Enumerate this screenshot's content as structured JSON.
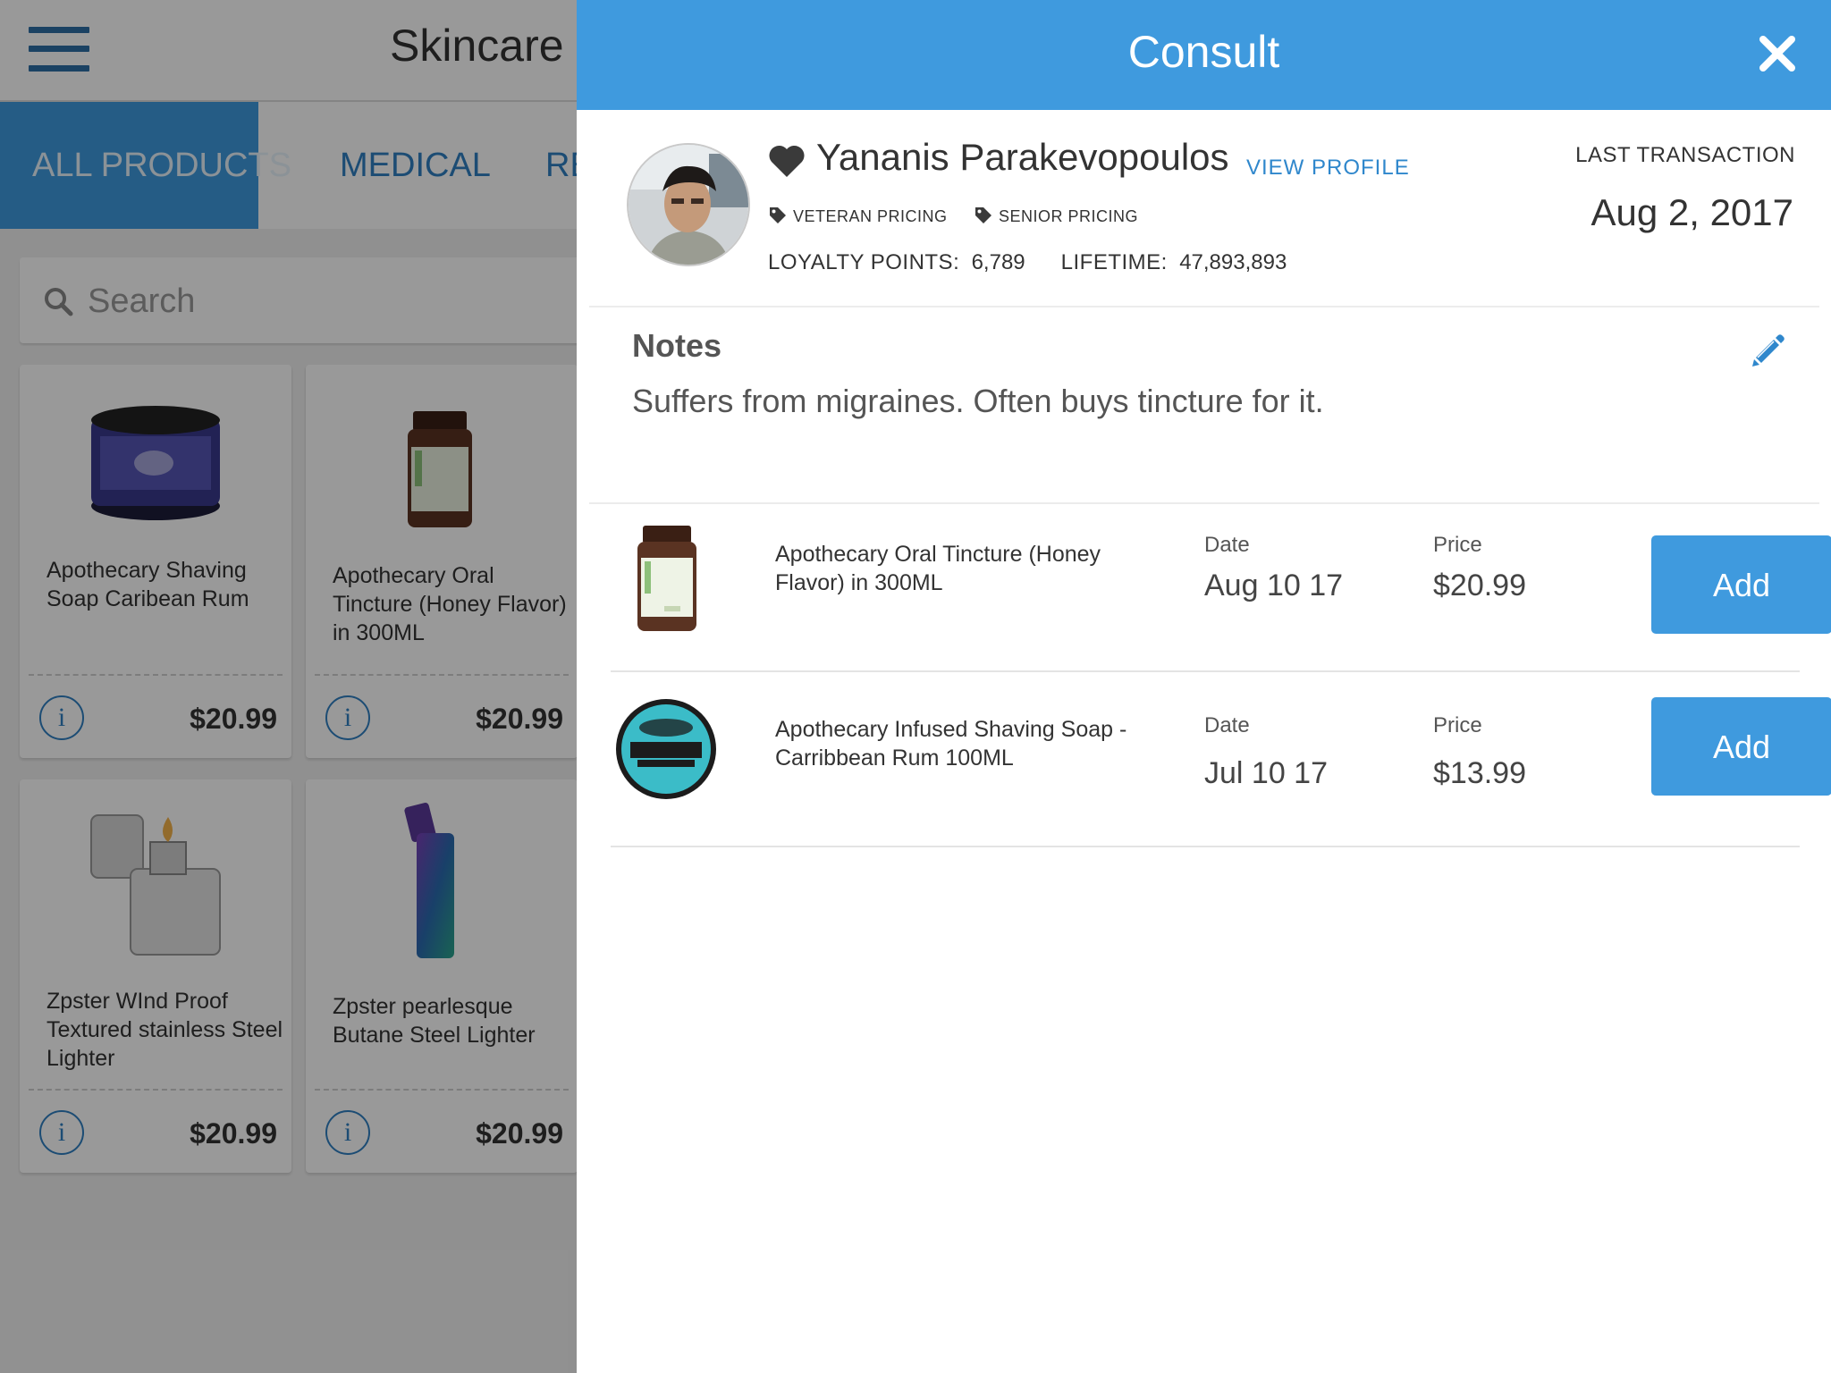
{
  "store": {
    "title": "Skincare",
    "tabs": [
      "ALL PRODUCTS",
      "MEDICAL",
      "RE"
    ],
    "search_placeholder": "Search",
    "products": [
      {
        "name": "Apothecary Shaving Soap Caribean Rum",
        "price": "$20.99"
      },
      {
        "name": "Apothecary Oral Tincture (Honey Flavor) in 300ML",
        "price": "$20.99"
      },
      {
        "name": "Zpster WInd Proof Textured stainless Steel Lighter",
        "price": "$20.99"
      },
      {
        "name": "Zpster pearlesque Butane Steel Lighter",
        "price": "$20.99"
      }
    ]
  },
  "consult": {
    "title": "Consult",
    "customer": {
      "name": "Yananis Parakevopoulos",
      "view_profile": "VIEW PROFILE",
      "badges": [
        "VETERAN PRICING",
        "SENIOR PRICING"
      ],
      "loyalty_label": "LOYALTY POINTS:",
      "loyalty_value": "6,789",
      "lifetime_label": "LIFETIME:",
      "lifetime_value": "47,893,893",
      "last_transaction_label": "LAST TRANSACTION",
      "last_transaction_date": "Aug 2, 2017"
    },
    "notes": {
      "title": "Notes",
      "text": "Suffers from migraines.  Often buys tincture for it."
    },
    "history": [
      {
        "name": "Apothecary Oral Tincture (Honey Flavor) in 300ML",
        "date_label": "Date",
        "date": "Aug 10 17",
        "price_label": "Price",
        "price": "$20.99",
        "button": "Add"
      },
      {
        "name": "Apothecary Infused Shaving Soap - Carribbean Rum 100ML",
        "date_label": "Date",
        "date": "Jul 10 17",
        "price_label": "Price",
        "price": "$13.99",
        "button": "Add"
      }
    ]
  },
  "colors": {
    "accent": "#3f9ade",
    "link": "#2f87cc",
    "overlay": "rgba(0,0,0,0.40)"
  },
  "icons": [
    "menu-icon",
    "search-icon",
    "info-icon",
    "close-icon",
    "heart-icon",
    "tag-icon",
    "edit-pencil-icon"
  ]
}
